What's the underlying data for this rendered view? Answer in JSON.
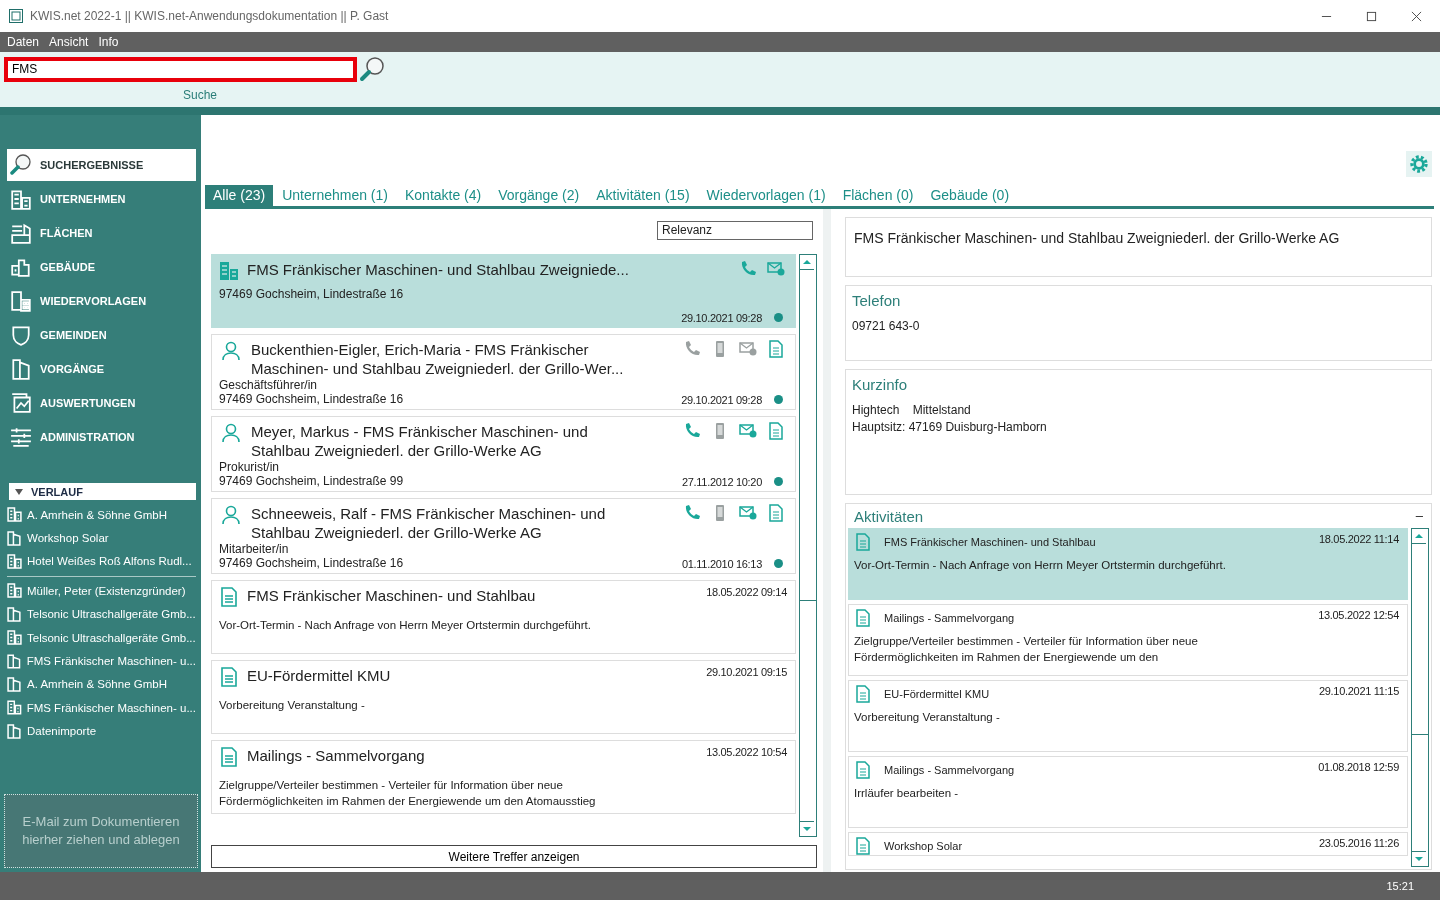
{
  "window": {
    "title": "KWIS.net 2022-1 || KWIS.net-Anwendungsdokumentation || P. Gast"
  },
  "menu": [
    "Daten",
    "Ansicht",
    "Info"
  ],
  "search": {
    "value": "FMS",
    "label": "Suche"
  },
  "sidebar": {
    "nav": [
      {
        "label": "SUCHERGEBNISSE",
        "kind": "search",
        "selected": true
      },
      {
        "label": "UNTERNEHMEN",
        "kind": "company",
        "selected": false
      },
      {
        "label": "FLÄCHEN",
        "kind": "areas",
        "selected": false
      },
      {
        "label": "GEBÄUDE",
        "kind": "buildings",
        "selected": false
      },
      {
        "label": "WIEDERVORLAGEN",
        "kind": "followups",
        "selected": false
      },
      {
        "label": "GEMEINDEN",
        "kind": "shield",
        "selected": false
      },
      {
        "label": "VORGÄNGE",
        "kind": "folder",
        "selected": false
      },
      {
        "label": "AUSWERTUNGEN",
        "kind": "chart",
        "selected": false
      },
      {
        "label": "ADMINISTRATION",
        "kind": "sliders",
        "selected": false
      }
    ],
    "history": {
      "title": "VERLAUF",
      "expanded": true,
      "groups": [
        [
          {
            "label": "A. Amrhein & Söhne GmbH",
            "kind": "company"
          },
          {
            "label": "Workshop Solar",
            "kind": "folder"
          },
          {
            "label": "Hotel Weißes Roß Alfons Rudl...",
            "kind": "company"
          }
        ],
        [
          {
            "label": "Müller, Peter (Existenzgründer)",
            "kind": "company"
          },
          {
            "label": "Telsonic Ultraschallgeräte Gmb...",
            "kind": "folder"
          },
          {
            "label": "Telsonic Ultraschallgeräte Gmb...",
            "kind": "company"
          },
          {
            "label": "FMS Fränkischer Maschinen- u...",
            "kind": "folder"
          },
          {
            "label": "A. Amrhein & Söhne GmbH",
            "kind": "folder"
          },
          {
            "label": "FMS Fränkischer Maschinen- u...",
            "kind": "company"
          },
          {
            "label": "Datenimporte",
            "kind": "folder"
          }
        ]
      ]
    },
    "dropzone": "E-Mail  zum Dokumentieren hierher ziehen und ablegen"
  },
  "tabs": [
    {
      "label": "Alle (23)",
      "selected": true
    },
    {
      "label": "Unternehmen (1)",
      "selected": false
    },
    {
      "label": "Kontakte (4)",
      "selected": false
    },
    {
      "label": "Vorgänge (2)",
      "selected": false
    },
    {
      "label": "Aktivitäten (15)",
      "selected": false
    },
    {
      "label": "Wiedervorlagen (1)",
      "selected": false
    },
    {
      "label": "Flächen (0)",
      "selected": false
    },
    {
      "label": "Gebäude (0)",
      "selected": false
    }
  ],
  "sort": "Relevanz",
  "results": [
    {
      "kind": "company",
      "selected": true,
      "title": "FMS Fränkischer Maschinen- und Stahlbau Zweigniede...",
      "address": "97469 Gochsheim, Lindestraße 16",
      "date": "29.10.2021 09:28",
      "actions": [
        {
          "kind": "phone",
          "enabled": true
        },
        {
          "kind": "mail",
          "enabled": true
        }
      ]
    },
    {
      "kind": "contact",
      "selected": false,
      "title": "Buckenthien-Eigler, Erich-Maria - FMS Fränkischer Maschinen- und Stahlbau Zweigniederl. der Grillo-Wer...",
      "role": "Geschäftsführer/in",
      "address": "97469 Gochsheim, Lindestraße 16",
      "date": "29.10.2021 09:28",
      "actions": [
        {
          "kind": "phone",
          "enabled": false
        },
        {
          "kind": "mobile",
          "enabled": false
        },
        {
          "kind": "mail",
          "enabled": false
        },
        {
          "kind": "doc",
          "enabled": true
        }
      ]
    },
    {
      "kind": "contact",
      "selected": false,
      "title": "Meyer, Markus - FMS Fränkischer Maschinen- und Stahlbau Zweigniederl. der Grillo-Werke AG",
      "role": "Prokurist/in",
      "address": "97469 Gochsheim, Lindestraße 99",
      "date": "27.11.2012 10:20",
      "actions": [
        {
          "kind": "phone",
          "enabled": true
        },
        {
          "kind": "mobile",
          "enabled": false
        },
        {
          "kind": "mail",
          "enabled": true
        },
        {
          "kind": "doc",
          "enabled": true
        }
      ]
    },
    {
      "kind": "contact",
      "selected": false,
      "title": "Schneeweis, Ralf - FMS Fränkischer Maschinen- und Stahlbau Zweigniederl. der Grillo-Werke AG",
      "role": "Mitarbeiter/in",
      "address": "97469 Gochsheim, Lindestraße 16",
      "date": "01.11.2010 16:13",
      "actions": [
        {
          "kind": "phone",
          "enabled": true
        },
        {
          "kind": "mobile",
          "enabled": false
        },
        {
          "kind": "mail",
          "enabled": true
        },
        {
          "kind": "doc",
          "enabled": true
        }
      ]
    },
    {
      "kind": "activity",
      "selected": false,
      "title": "FMS Fränkischer Maschinen- und Stahlbau",
      "date": "18.05.2022 09:14",
      "text": "Vor-Ort-Termin - Nach Anfrage von Herrn Meyer Ortstermin durchgeführt."
    },
    {
      "kind": "activity",
      "selected": false,
      "title": "EU-Fördermittel KMU",
      "date": "29.10.2021 09:15",
      "text": "Vorbereitung Veranstaltung -"
    },
    {
      "kind": "activity",
      "selected": false,
      "title": "Mailings - Sammelvorgang",
      "date": "13.05.2022 10:54",
      "text": "Zielgruppe/Verteiler bestimmen - Verteiler für Information über neue Fördermöglichkeiten im Rahmen der Energiewende um den Atomausstieg"
    }
  ],
  "more_button": "Weitere Treffer anzeigen",
  "detail": {
    "title": "FMS Fränkischer Maschinen- und Stahlbau Zweigniederl. der Grillo-Werke AG",
    "phone": {
      "heading": "Telefon",
      "value": "09721 643-0"
    },
    "info": {
      "heading": "Kurzinfo",
      "lines": [
        "Hightech    Mittelstand",
        "Hauptsitz: 47169 Duisburg-Hamborn"
      ]
    },
    "activities": {
      "heading": "Aktivitäten",
      "collapse": "–",
      "items": [
        {
          "title": "FMS Fränkischer Maschinen- und Stahlbau",
          "date": "18.05.2022 11:14",
          "text": "Vor-Ort-Termin - Nach Anfrage von Herrn Meyer Ortstermin durchgeführt.",
          "selected": true
        },
        {
          "title": "Mailings - Sammelvorgang",
          "date": "13.05.2022 12:54",
          "text": "Zielgruppe/Verteiler bestimmen - Verteiler für Information über neue Fördermöglichkeiten im Rahmen der Energiewende um den",
          "selected": false
        },
        {
          "title": "EU-Fördermittel KMU",
          "date": "29.10.2021 11:15",
          "text": "Vorbereitung Veranstaltung -",
          "selected": false
        },
        {
          "title": "Mailings - Sammelvorgang",
          "date": "01.08.2018 12:59",
          "text": "Irrläufer bearbeiten -",
          "selected": false
        },
        {
          "title": "Workshop Solar",
          "date": "23.05.2016 11:26",
          "selected": false
        }
      ]
    }
  },
  "status_time": "15:21"
}
